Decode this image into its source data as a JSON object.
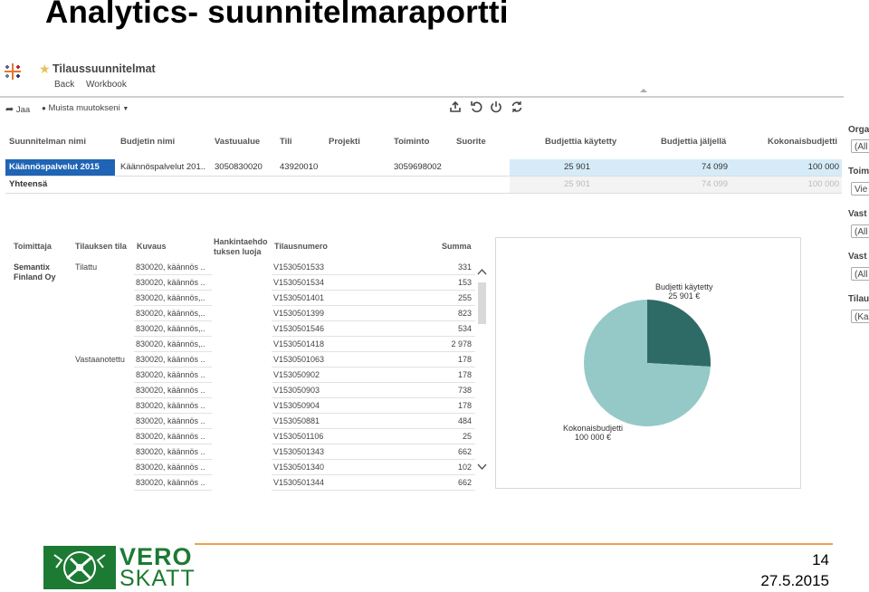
{
  "slide": {
    "title": "Analytics- suunnitelmaraportti",
    "page_number": "14",
    "date": "27.5.2015",
    "brand_line1": "VERO",
    "brand_line2": "SKATT",
    "brand_color": "#1c7a33",
    "accent_line_color": "#f0a050"
  },
  "app": {
    "workbook_title": "Tilaussuunnitelmat",
    "nav": {
      "back": "Back",
      "workbook": "Workbook"
    },
    "toolbar": {
      "share": "Jaa",
      "remember": "Muista muutokseni"
    },
    "icons": [
      "share-icon",
      "star-icon",
      "upload-icon",
      "revert-icon",
      "power-icon",
      "refresh-icon"
    ]
  },
  "top_table": {
    "headers": [
      "Suunnitelman nimi",
      "Budjetin nimi",
      "Vastuualue",
      "Tili",
      "Projekti",
      "Toiminto",
      "Suorite",
      "Budjettia käytetty",
      "Budjettia jäljellä",
      "Kokonaisbudjetti"
    ],
    "row": {
      "nimi": "Käännöspalvelut 2015",
      "budjetti": "Käännöspalvelut 201..",
      "vastuualue": "3050830020",
      "tili": "43920010",
      "toiminto": "3059698002",
      "kaytetty": "25 901",
      "jaljella": "74 099",
      "kokonais": "100 000"
    },
    "total": {
      "label": "Yhteensä",
      "kaytetty": "25 901",
      "jaljella": "74 099",
      "kokonais": "100 000"
    },
    "selected_color": "#1f64b5"
  },
  "filters": [
    {
      "label": "Orga",
      "value": "(All"
    },
    {
      "label": "Toim",
      "value": "Vie"
    },
    {
      "label": "Vast",
      "value": "(All"
    },
    {
      "label": "Vast",
      "value": "(All"
    },
    {
      "label": "Tilau",
      "value": "(Ka"
    }
  ],
  "detail_table": {
    "headers": {
      "toimittaja": "Toimittaja",
      "tila": "Tilauksen tila",
      "kuvaus": "Kuvaus",
      "hankinta_1": "Hankintaehdo",
      "hankinta_2": "tuksen luoja",
      "tilausnumero": "Tilausnumero",
      "summa": "Summa"
    },
    "supplier_1": "Semantix",
    "supplier_2": "Finland Oy",
    "status_1": "Tilattu",
    "status_2": "Vastaanotettu",
    "rows": [
      {
        "kuvaus": "830020, käännös ..",
        "numero": "V1530501533",
        "summa": "331"
      },
      {
        "kuvaus": "830020, käännös ..",
        "numero": "V1530501534",
        "summa": "153"
      },
      {
        "kuvaus": "830020, käännös,..",
        "numero": "V1530501401",
        "summa": "255"
      },
      {
        "kuvaus": "830020, käännös,..",
        "numero": "V1530501399",
        "summa": "823"
      },
      {
        "kuvaus": "830020, käännös,..",
        "numero": "V1530501546",
        "summa": "534"
      },
      {
        "kuvaus": "830020, käännös,..",
        "numero": "V1530501418",
        "summa": "2 978"
      },
      {
        "kuvaus": "830020, käännös ..",
        "numero": "V1530501063",
        "summa": "178"
      },
      {
        "kuvaus": "830020, käännös ..",
        "numero": "V153050902",
        "summa": "178"
      },
      {
        "kuvaus": "830020, käännös ..",
        "numero": "V153050903",
        "summa": "738"
      },
      {
        "kuvaus": "830020, käännös ..",
        "numero": "V153050904",
        "summa": "178"
      },
      {
        "kuvaus": "830020, käännös ..",
        "numero": "V153050881",
        "summa": "484"
      },
      {
        "kuvaus": "830020, käännös ..",
        "numero": "V1530501106",
        "summa": "25"
      },
      {
        "kuvaus": "830020, käännös ..",
        "numero": "V1530501343",
        "summa": "662"
      },
      {
        "kuvaus": "830020, käännös ..",
        "numero": "V1530501340",
        "summa": "102"
      },
      {
        "kuvaus": "830020, käännös ..",
        "numero": "V1530501344",
        "summa": "662"
      }
    ]
  },
  "chart_data": {
    "type": "pie",
    "series": [
      {
        "name": "Budjetti käytetty",
        "label_value": "25 901 €",
        "value": 25901,
        "color": "#2e6b66"
      },
      {
        "name": "Kokonaisbudjetti",
        "label_value": "100 000 €",
        "value": 74099,
        "color": "#95c9c8"
      }
    ]
  }
}
